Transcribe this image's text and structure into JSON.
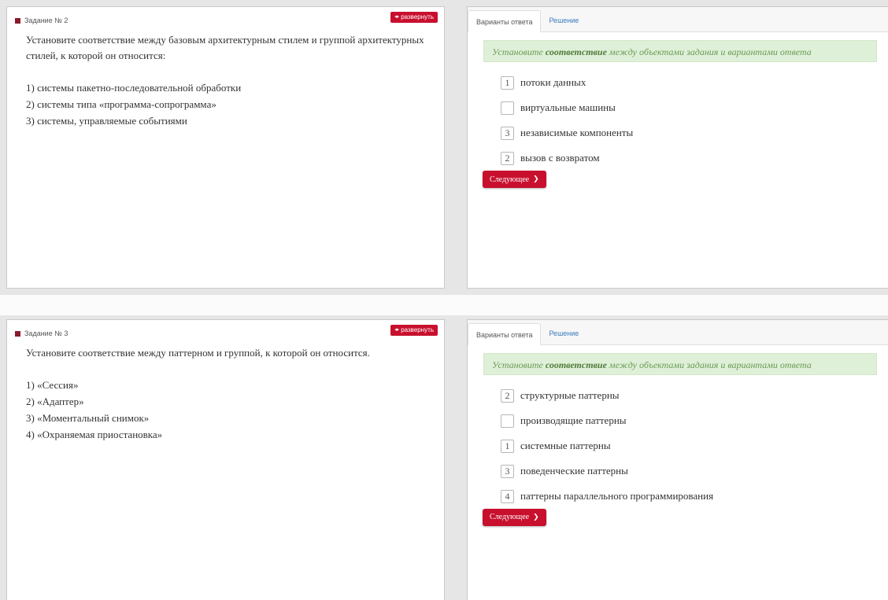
{
  "colors": {
    "accent": "#c8102e",
    "task_marker": "#8b1a2b",
    "instruction_bg": "#dff0d8",
    "instruction_text": "#6a9a55",
    "tab_link": "#3a7bbf"
  },
  "icons": {
    "task_marker": "square-icon",
    "expand": "expand-arrows-icon",
    "next": "chevron-right-icon"
  },
  "tasks": [
    {
      "header": "Задание № 2",
      "expand_label": "развернуть",
      "question": "Установите соответствие между базовым архитектурным стилем и группой архитектурных стилей, к которой он относится:",
      "items": [
        "1) системы пакетно-последовательной обработки",
        "2) системы типа «программа-сопрограмма»",
        "3) системы, управляемые событиями"
      ],
      "tabs": {
        "answers": "Варианты ответа",
        "solution": "Решение"
      },
      "instruction": {
        "pre": "Установите ",
        "bold": "соответствие",
        "post": " между объектами задания и вариантами ответа"
      },
      "options": [
        {
          "value": "1",
          "label": "потоки данных"
        },
        {
          "value": "",
          "label": "виртуальные машины"
        },
        {
          "value": "3",
          "label": "независимые компоненты"
        },
        {
          "value": "2",
          "label": "вызов с возвратом"
        }
      ],
      "next_label": "Следующее"
    },
    {
      "header": "Задание № 3",
      "expand_label": "развернуть",
      "question": "Установите соответствие между паттерном и группой, к которой он относится.",
      "items": [
        "1) «Сессия»",
        "2) «Адаптер»",
        "3) «Моментальный снимок»",
        "4) «Охраняемая приостановка»"
      ],
      "tabs": {
        "answers": "Варианты ответа",
        "solution": "Решение"
      },
      "instruction": {
        "pre": "Установите ",
        "bold": "соответствие",
        "post": " между объектами задания и вариантами ответа"
      },
      "options": [
        {
          "value": "2",
          "label": "структурные паттерны"
        },
        {
          "value": "",
          "label": "производящие паттерны"
        },
        {
          "value": "1",
          "label": "системные паттерны"
        },
        {
          "value": "3",
          "label": "поведенческие паттерны"
        },
        {
          "value": "4",
          "label": "паттерны параллельного программирования"
        }
      ],
      "next_label": "Следующее"
    }
  ]
}
